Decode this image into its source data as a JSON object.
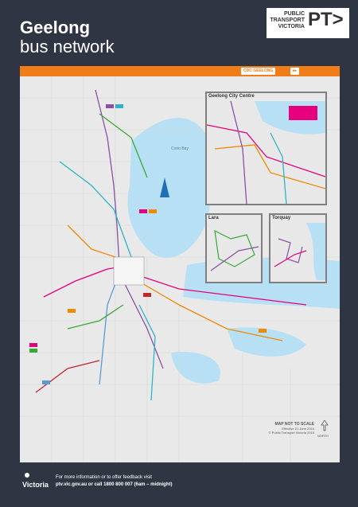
{
  "header": {
    "title_line1": "Geelong",
    "title_line2": "bus network",
    "brand_line1": "PUBLIC",
    "brand_line2": "TRANSPORT",
    "brand_line3": "VICTORIA",
    "brand_mark": "PT>"
  },
  "map": {
    "operator_logo": "CDC GEELONG",
    "inset_city": "Geelong City Centre",
    "inset_lara": "Lara",
    "inset_torquay": "Torquay",
    "note_line1": "MAP NOT TO SCALE",
    "note_line2": "Effective 21 June 2015",
    "note_line3": "© Public Transport Victoria 2015",
    "north_label": "NORTH",
    "water_label": "Corio Bay"
  },
  "footer": {
    "line1": "For more information or to offer feedback visit",
    "line2": "ptv.vic.gov.au or call 1800 800 007 (6am – midnight)",
    "gov_logo": "Victoria"
  },
  "colors": {
    "background": "#2f3542",
    "orange": "#ef7d1a",
    "water": "#b8e0f4",
    "land": "#e9e9e9"
  }
}
